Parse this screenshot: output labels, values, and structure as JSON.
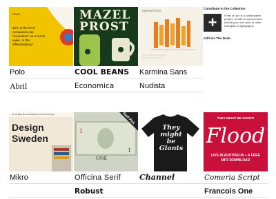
{
  "cards": [
    {
      "label1": "Polo",
      "label2": "Abril",
      "thumb_text": "45% of the DAX companies use “innovation” as a brand value. Is this differentiating?"
    },
    {
      "label1": "COOL BEANS",
      "label2": "Economica",
      "thumb_text": "MAZEL PROST"
    },
    {
      "label1": "Karmina Sans",
      "label2": "Nudista",
      "thumb_text": "HIER ENTSTEHT"
    },
    {
      "label1": "Mikro",
      "label2": "",
      "thumb_text": "Design Sweden",
      "thumb_nav": "Home  Blog  About  Newsletter  Jobs  Community"
    },
    {
      "label1": "Officina Serif",
      "label2": "Robust",
      "thumb_text": "ONE",
      "ribbon": "Staff Pick"
    },
    {
      "label1": "Channel",
      "label2": "",
      "thumb_text": "They might be Giants"
    },
    {
      "label1": "Comeria Script",
      "label2": "Francois One",
      "thumb_text": "Flood",
      "thumb_top": "THEY MIGHT BE GIANTS",
      "thumb_bottom": "LIVE IN AUSTRALIA + A FREE MP3 DOWNLOAD"
    }
  ],
  "contribute": {
    "heading": "Contribute to the Collection",
    "plus": "+",
    "text": "Fonts in Use is a collaborative project. Create an account and submit your own work or other examples of typography.",
    "deck": "Add Via The Deck"
  }
}
